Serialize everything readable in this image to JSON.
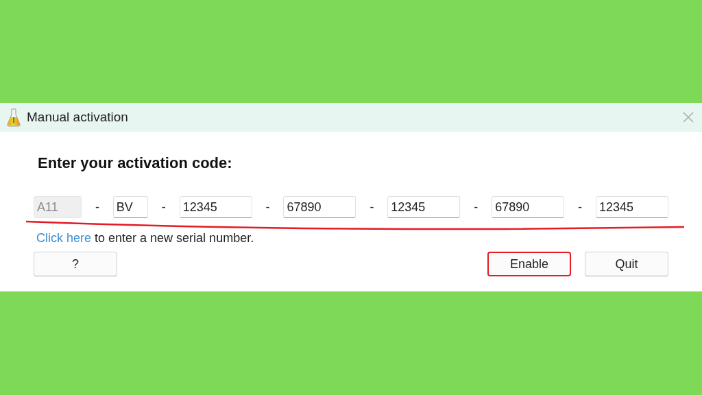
{
  "window": {
    "title": "Manual activation"
  },
  "heading": "Enter your activation code:",
  "code_row": {
    "underlined": true,
    "separator": "-",
    "fields": [
      {
        "value": "A11",
        "disabled": true
      },
      {
        "value": "BV",
        "disabled": false
      },
      {
        "value": "12345",
        "disabled": false
      },
      {
        "value": "67890",
        "disabled": false
      },
      {
        "value": "12345",
        "disabled": false
      },
      {
        "value": "67890",
        "disabled": false
      },
      {
        "value": "12345",
        "disabled": false
      }
    ]
  },
  "hint": {
    "link": "Click here",
    "text": " to enter a new serial number."
  },
  "buttons": [
    {
      "label": "?",
      "highlighted": false
    },
    {
      "label": "Enable",
      "highlighted": true
    },
    {
      "label": "Quit",
      "highlighted": false
    }
  ]
}
